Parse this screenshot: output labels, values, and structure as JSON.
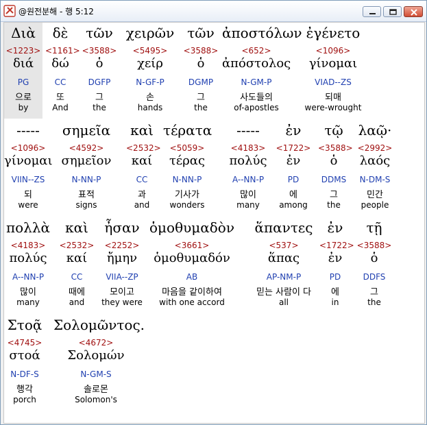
{
  "window": {
    "title": "@원전분해 - 행 5:12",
    "icon": "bible-app-icon",
    "controls": [
      "minimize-icon",
      "maximize-icon",
      "close-icon"
    ]
  },
  "rows": [
    [
      {
        "greek": "Διὰ",
        "strong": "<1223>",
        "lexeme": "διά",
        "morph": "PG",
        "korean": "으로",
        "english": "by",
        "selected": true
      },
      {
        "greek": "δὲ",
        "strong": "<1161>",
        "lexeme": "δώ",
        "morph": "CC",
        "korean": "또",
        "english": "And"
      },
      {
        "greek": "τῶν",
        "strong": "<3588>",
        "lexeme": "ὁ",
        "morph": "DGFP",
        "korean": "그",
        "english": "the"
      },
      {
        "greek": "χειρῶν",
        "strong": "<5495>",
        "lexeme": "χείρ",
        "morph": "N-GF-P",
        "korean": "손",
        "english": "hands"
      },
      {
        "greek": "τῶν",
        "strong": "<3588>",
        "lexeme": "ὁ",
        "morph": "DGMP",
        "korean": "그",
        "english": "the"
      },
      {
        "greek": "ἀποστόλων",
        "strong": "<652>",
        "lexeme": "ἀπόστολος",
        "morph": "N-GM-P",
        "korean": "사도들의",
        "english": "of-apostles"
      },
      {
        "greek": "ἐγένετο",
        "strong": "<1096>",
        "lexeme": "γίνομαι",
        "morph": "VIAD--ZS",
        "korean": "되매",
        "english": "were-wrought"
      }
    ],
    [
      {
        "greek": "-----",
        "strong": "<1096>",
        "lexeme": "γίνομαι",
        "morph": "VIIN--ZS",
        "korean": "되",
        "english": "were"
      },
      {
        "greek": "σημεῖα",
        "strong": "<4592>",
        "lexeme": "σημεῖον",
        "morph": "N-NN-P",
        "korean": "표적",
        "english": "signs"
      },
      {
        "greek": "καὶ",
        "strong": "<2532>",
        "lexeme": "καί",
        "morph": "CC",
        "korean": "과",
        "english": "and"
      },
      {
        "greek": "τέρατα",
        "strong": "<5059>",
        "lexeme": "τέρας",
        "morph": "N-NN-P",
        "korean": "기사가",
        "english": "wonders"
      },
      {
        "greek": "-----",
        "strong": "<4183>",
        "lexeme": "πολύς",
        "morph": "A--NN-P",
        "korean": "많이",
        "english": "many"
      },
      {
        "greek": "ἐν",
        "strong": "<1722>",
        "lexeme": "ἐν",
        "morph": "PD",
        "korean": "에",
        "english": "among"
      },
      {
        "greek": "τῷ",
        "strong": "<3588>",
        "lexeme": "ὁ",
        "morph": "DDMS",
        "korean": "그",
        "english": "the"
      },
      {
        "greek": "λαῷ·",
        "strong": "<2992>",
        "lexeme": "λαός",
        "morph": "N-DM-S",
        "korean": "민간",
        "english": "people"
      }
    ],
    [
      {
        "greek": "πολλὰ",
        "strong": "<4183>",
        "lexeme": "πολύς",
        "morph": "A--NN-P",
        "korean": "많이",
        "english": "many"
      },
      {
        "greek": "καὶ",
        "strong": "<2532>",
        "lexeme": "καί",
        "morph": "CC",
        "korean": "때에",
        "english": "and"
      },
      {
        "greek": "ἦσαν",
        "strong": "<2252>",
        "lexeme": "ἤμην",
        "morph": "VIIA--ZP",
        "korean": "모이고",
        "english": "they were"
      },
      {
        "greek": "ὁμοθυμαδὸν",
        "strong": "<3661>",
        "lexeme": "ὁμοθυμαδόν",
        "morph": "AB",
        "korean": "마음을 같이하여",
        "english": "with one accord"
      },
      {
        "greek": "ἅπαντες",
        "strong": "<537>",
        "lexeme": "ἅπας",
        "morph": "AP-NM-P",
        "korean": "믿는 사람이 다",
        "english": "all"
      },
      {
        "greek": "ἐν",
        "strong": "<1722>",
        "lexeme": "ἐν",
        "morph": "PD",
        "korean": "에",
        "english": "in"
      },
      {
        "greek": "τῇ",
        "strong": "<3588>",
        "lexeme": "ὁ",
        "morph": "DDFS",
        "korean": "그",
        "english": "the"
      }
    ],
    [
      {
        "greek": "Στοᾷ",
        "strong": "<4745>",
        "lexeme": "στοά",
        "morph": "N-DF-S",
        "korean": "행각",
        "english": "porch"
      },
      {
        "greek": "Σολομῶντος.",
        "strong": "<4672>",
        "lexeme": "Σολομών",
        "morph": "N-GM-S",
        "korean": "솔로몬",
        "english": "Solomon's"
      }
    ]
  ],
  "colors": {
    "strong": "#a01010",
    "morph": "#1f3fb0",
    "selected_bg": "#e6e6e6"
  }
}
